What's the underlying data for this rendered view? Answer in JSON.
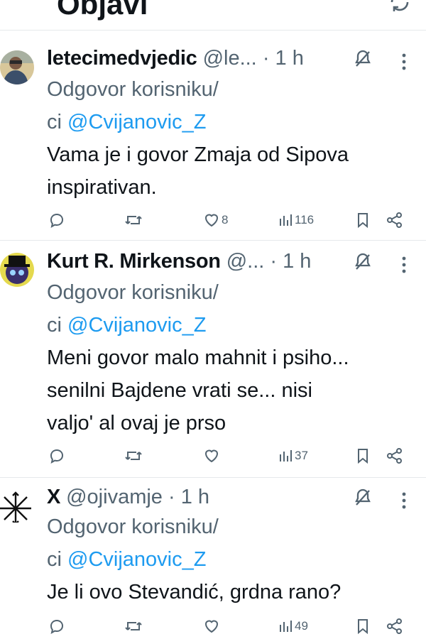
{
  "header": {
    "title": "Objavi"
  },
  "reply_prefix_1": "Odgovor korisniku/",
  "reply_prefix_2": "ci",
  "posts": [
    {
      "display_name": "letecimedvjedic",
      "handle": "@le...",
      "time": "· 1 h",
      "reply_to": "@Cvijanovic_Z",
      "text_lines": [
        "Vama je i govor Zmaja od Sipova",
        "inspirativan."
      ],
      "likes": "8",
      "views": "116"
    },
    {
      "display_name": "Kurt R. Mirkenson",
      "handle": "@...",
      "time": "· 1 h",
      "reply_to": "@Cvijanovic_Z",
      "text_lines": [
        "Meni govor malo mahnit i psiho...",
        "senilni Bajdene vrati se... nisi",
        "valjo' al ovaj je prso"
      ],
      "likes": "",
      "views": "37"
    },
    {
      "display_name": "X",
      "handle": "@ojivamje",
      "time": "· 1 h",
      "reply_to": "@Cvijanovic_Z",
      "text_lines": [
        "Je li ovo Stevandić, grdna rano?"
      ],
      "likes": "",
      "views": "49"
    }
  ],
  "icons": {
    "reply": "reply-icon",
    "repost": "repost-icon",
    "like": "heart-icon",
    "views": "views-icon",
    "bookmark": "bookmark-icon",
    "share": "share-icon",
    "muted": "muted-icon",
    "more": "more-icon"
  },
  "colors": {
    "link": "#1d9bf0",
    "muted": "#536471",
    "text": "#0f1419"
  }
}
